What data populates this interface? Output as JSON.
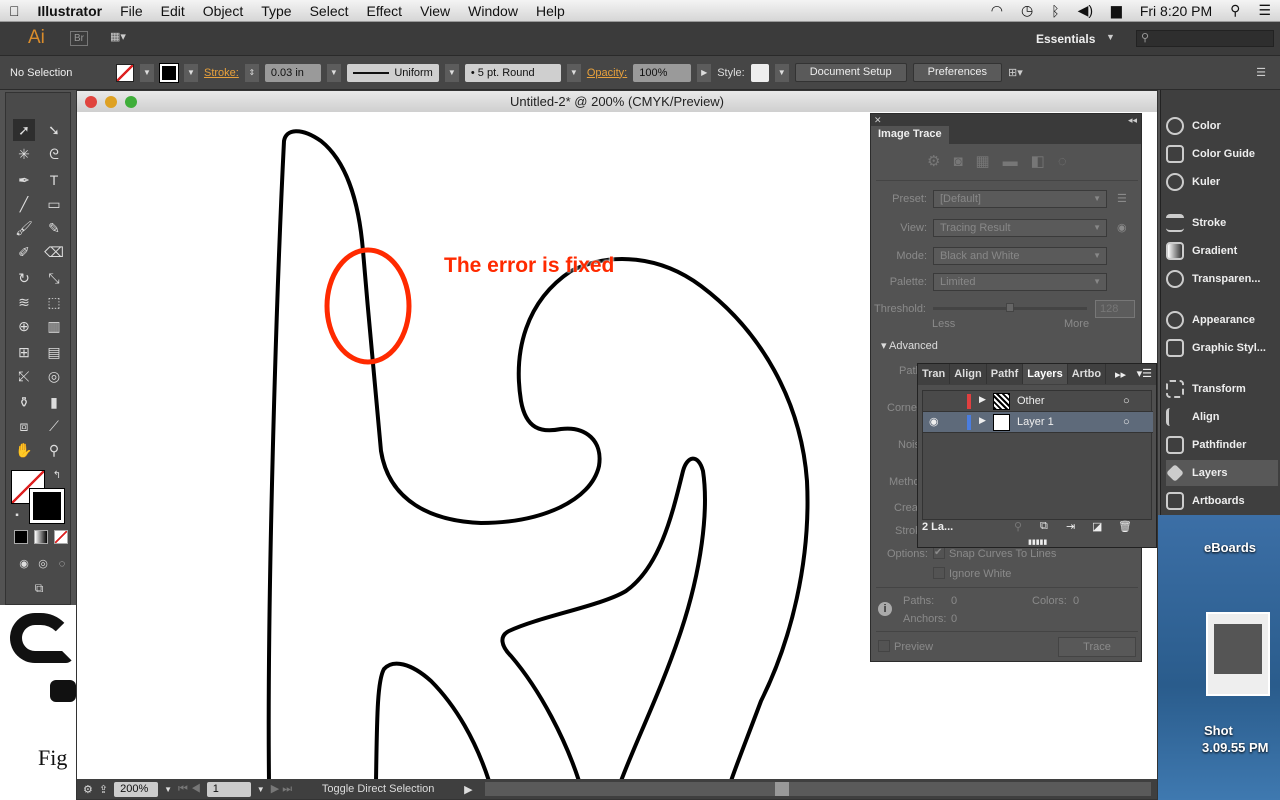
{
  "menubar": {
    "app": "Illustrator",
    "items": [
      "File",
      "Edit",
      "Object",
      "Type",
      "Select",
      "Effect",
      "View",
      "Window",
      "Help"
    ],
    "clock": "Fri 8:20 PM"
  },
  "appbar": {
    "logo": "Ai",
    "bridge": "Br",
    "workspace": "Essentials"
  },
  "control": {
    "selection": "No Selection",
    "stroke_label": "Stroke:",
    "stroke_value": "0.03 in",
    "profile": "Uniform",
    "brush": "5 pt. Round",
    "opacity_label": "Opacity:",
    "opacity_value": "100%",
    "style_label": "Style:",
    "document_setup": "Document Setup",
    "preferences": "Preferences"
  },
  "document": {
    "title": "Untitled-2* @ 200% (CMYK/Preview)",
    "annotation": "The error is fixed",
    "annotation_color": "#ff2a00"
  },
  "status": {
    "zoom": "200%",
    "page": "1",
    "message": "Toggle Direct Selection"
  },
  "image_trace": {
    "title": "Image Trace",
    "preset_label": "Preset:",
    "preset": "[Default]",
    "view_label": "View:",
    "view": "Tracing Result",
    "mode_label": "Mode:",
    "mode": "Black and White",
    "palette_label": "Palette:",
    "palette": "Limited",
    "threshold_label": "Threshold:",
    "threshold": "128",
    "less": "Less",
    "more": "More",
    "advanced": "Advanced",
    "paths_label": "Path",
    "corners_label": "Corne",
    "noise_label": "Nois",
    "method_label": "Metho",
    "create_label": "Crea",
    "stroke_label": "Strok",
    "options_label": "Options:",
    "snap": "Snap Curves To Lines",
    "snap_checked": true,
    "ignore_white": "Ignore White",
    "ignore_white_checked": false,
    "paths_count_label": "Paths:",
    "paths_count": "0",
    "anchors_label": "Anchors:",
    "anchors": "0",
    "colors_label": "Colors:",
    "colors": "0",
    "preview": "Preview",
    "trace": "Trace"
  },
  "layers_panel": {
    "tabs": [
      "Tran",
      "Align",
      "Pathf",
      "Layers",
      "Artbo"
    ],
    "active_tab": "Layers",
    "layers": [
      {
        "name": "Other",
        "color": "#e04040",
        "visible": false
      },
      {
        "name": "Layer 1",
        "color": "#4a7de0",
        "visible": true
      }
    ],
    "count": "2 La..."
  },
  "dock": {
    "items": [
      "Color",
      "Color Guide",
      "Kuler",
      "Stroke",
      "Gradient",
      "Transparen...",
      "Appearance",
      "Graphic Styl...",
      "Transform",
      "Align",
      "Pathfinder",
      "Layers",
      "Artboards"
    ]
  },
  "desktop": {
    "label1": "eBoards",
    "label2": "Shot",
    "label3": "3.09.55 PM",
    "left_text": "Fig"
  }
}
